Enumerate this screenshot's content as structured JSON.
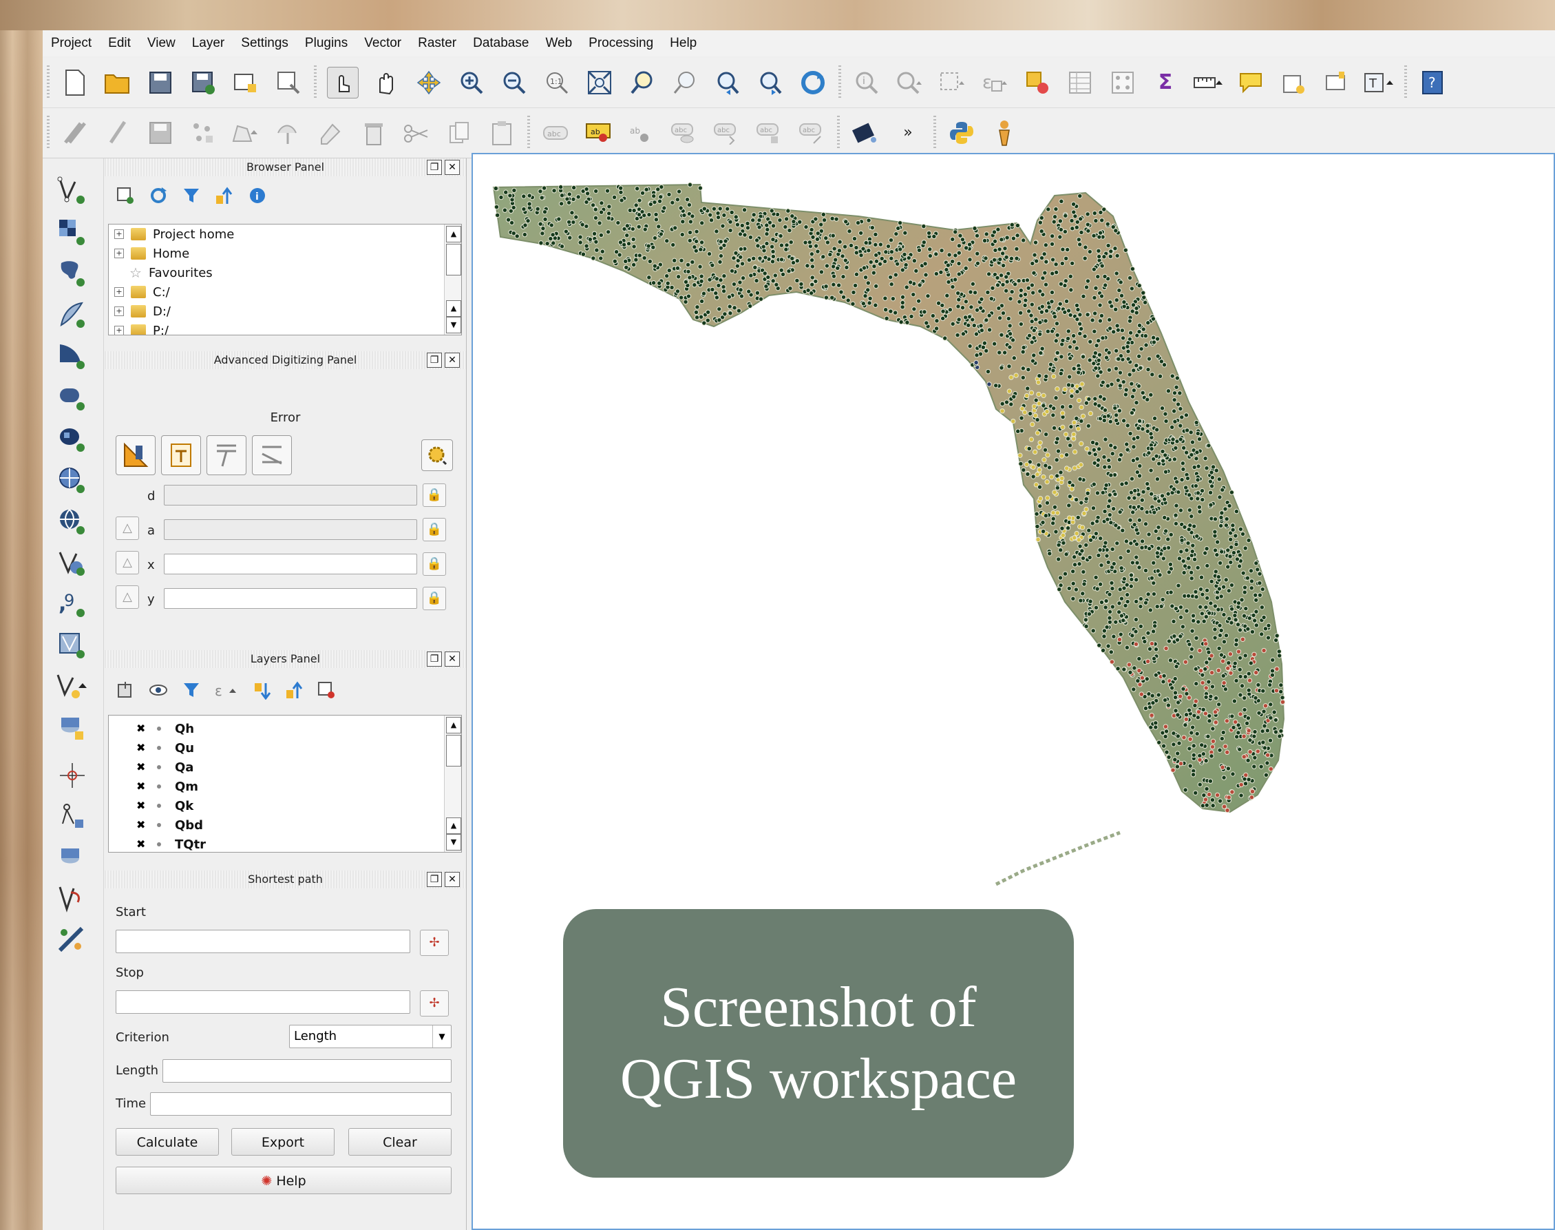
{
  "menubar": [
    "Project",
    "Edit",
    "View",
    "Layer",
    "Settings",
    "Plugins",
    "Vector",
    "Raster",
    "Database",
    "Web",
    "Processing",
    "Help"
  ],
  "browser_panel": {
    "title": "Browser Panel",
    "items": [
      "Project home",
      "Home",
      "Favourites",
      "C:/",
      "D:/",
      "P:/"
    ]
  },
  "digitizing_panel": {
    "title": "Advanced Digitizing Panel",
    "error_label": "Error",
    "fields": [
      "d",
      "a",
      "x",
      "y"
    ]
  },
  "layers_panel": {
    "title": "Layers Panel",
    "layers": [
      "Qh",
      "Qu",
      "Qa",
      "Qm",
      "Qk",
      "Qbd",
      "TQtr"
    ]
  },
  "shortest_path": {
    "title": "Shortest path",
    "start_label": "Start",
    "stop_label": "Stop",
    "criterion_label": "Criterion",
    "criterion_value": "Length",
    "length_label": "Length",
    "time_label": "Time",
    "calculate": "Calculate",
    "export": "Export",
    "clear": "Clear",
    "help": "Help"
  },
  "caption": {
    "line1": "Screenshot of",
    "line2": "QGIS workspace"
  },
  "colors": {
    "caption_bg": "#6b7e70",
    "map_border": "#6aa0d8",
    "land_green": "#7e9a6f",
    "land_tan": "#b9a37f",
    "point_dark": "#163a1c"
  }
}
